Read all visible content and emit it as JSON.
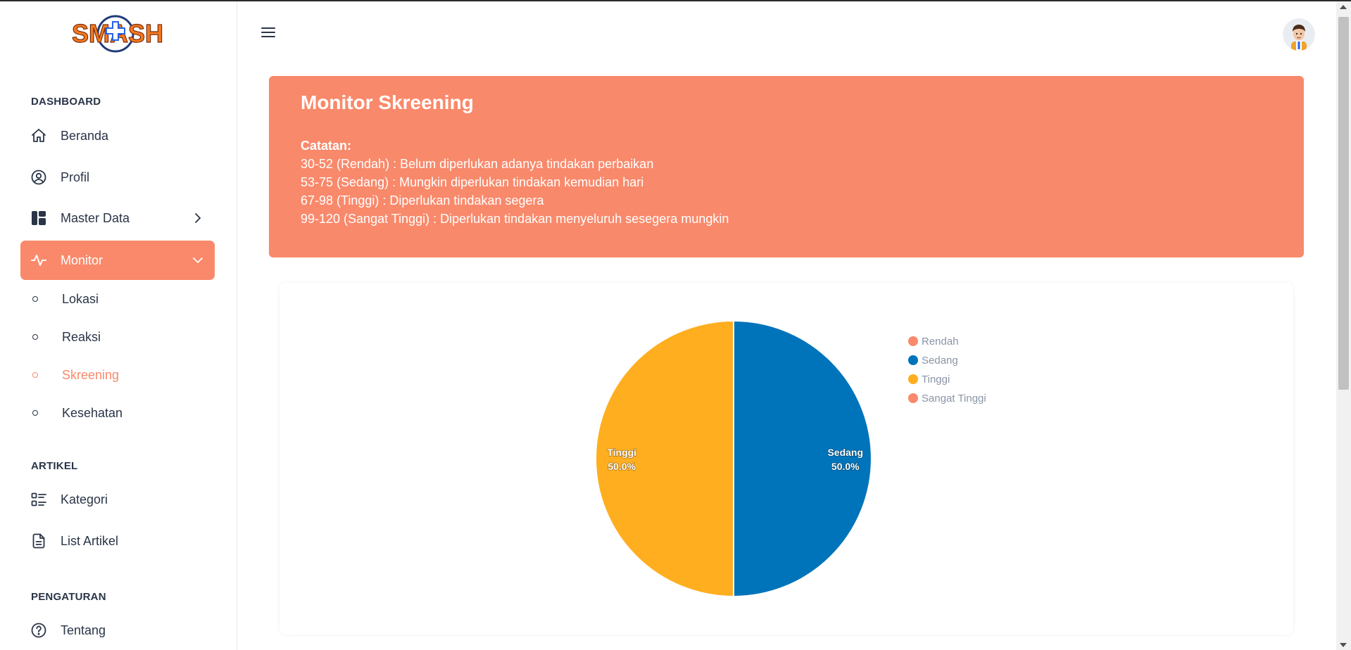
{
  "app": {
    "logo_text": "SMASH"
  },
  "sidebar": {
    "sections": [
      {
        "title": "DASHBOARD"
      },
      {
        "title": "ARTIKEL"
      },
      {
        "title": "PENGATURAN"
      }
    ],
    "items": [
      {
        "label": "Beranda",
        "icon": "home-icon"
      },
      {
        "label": "Profil",
        "icon": "user-circle-icon"
      },
      {
        "label": "Master Data",
        "icon": "layout-icon"
      },
      {
        "label": "Monitor",
        "icon": "activity-icon"
      },
      {
        "label": "Kategori",
        "icon": "list-details-icon"
      },
      {
        "label": "List Artikel",
        "icon": "file-text-icon"
      },
      {
        "label": "Tentang",
        "icon": "help-circle-icon"
      }
    ],
    "monitor_sub": [
      {
        "label": "Lokasi"
      },
      {
        "label": "Reaksi"
      },
      {
        "label": "Skreening"
      },
      {
        "label": "Kesehatan"
      }
    ]
  },
  "banner": {
    "title": "Monitor Skreening",
    "note_title": "Catatan:",
    "notes": [
      "30-52 (Rendah) : Belum diperlukan adanya tindakan perbaikan",
      "53-75 (Sedang) : Mungkin diperlukan tindakan kemudian hari",
      "67-98 (Tinggi) : Diperlukan tindakan segera",
      "99-120 (Sangat Tinggi) : Diperlukan tindakan menyeluruh sesegera mungkin"
    ]
  },
  "colors": {
    "accent": "#fa896b",
    "rendah": "#fa896b",
    "sedang": "#0074ba",
    "tinggi": "#ffae1f",
    "sangat_tinggi": "#fa896b"
  },
  "chart_data": {
    "type": "pie",
    "categories": [
      "Rendah",
      "Sedang",
      "Tinggi",
      "Sangat Tinggi"
    ],
    "values": [
      0,
      50,
      50,
      0
    ],
    "data_labels": [
      "",
      "Sedang\n50.0%",
      "Tinggi\n50.0%",
      ""
    ],
    "legend": "right"
  }
}
